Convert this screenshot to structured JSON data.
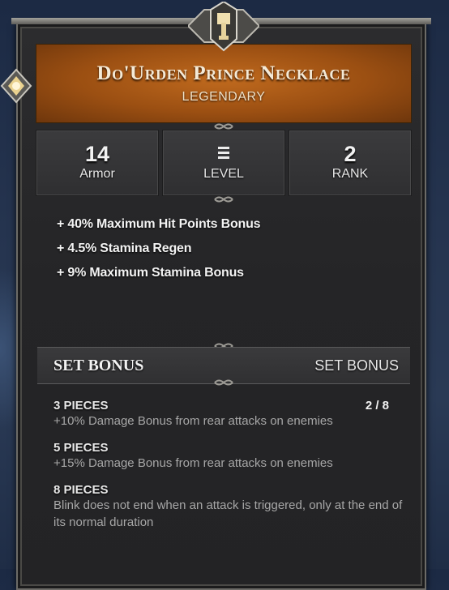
{
  "item": {
    "name": "Do'Urden Prince Necklace",
    "quality": "LEGENDARY",
    "quality_color": "#a65512"
  },
  "stats": [
    {
      "value": "14",
      "label": "Armor"
    },
    {
      "value": "",
      "label": "LEVEL",
      "icon": "level-bars-icon"
    },
    {
      "value": "2",
      "label": "RANK"
    }
  ],
  "bonuses": [
    "+ 40% Maximum Hit Points Bonus",
    "+ 4.5% Stamina Regen",
    "+ 9% Maximum Stamina Bonus"
  ],
  "set": {
    "title": "SET BONUS",
    "subtitle": "SET BONUS",
    "progress": "2 / 8",
    "tiers": [
      {
        "pieces": "3 PIECES",
        "description": "+10% Damage Bonus from rear attacks on enemies"
      },
      {
        "pieces": "5 PIECES",
        "description": "+15% Damage Bonus from rear attacks on enemies"
      },
      {
        "pieces": "8 PIECES",
        "description": "Blink does not end when an attack is triggered, only at the end of its normal duration"
      }
    ]
  }
}
